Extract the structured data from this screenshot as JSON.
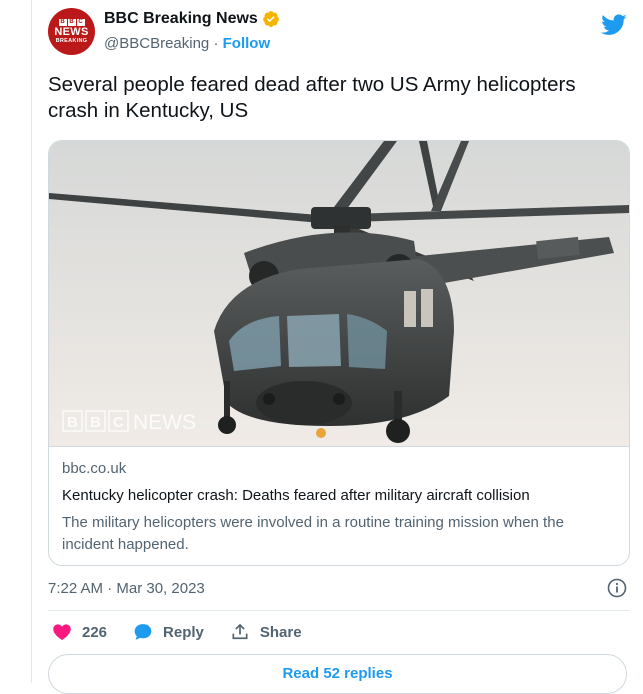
{
  "author": {
    "display_name": "BBC Breaking News",
    "handle": "@BBCBreaking",
    "separator": " · ",
    "follow_label": "Follow",
    "avatar": {
      "blocks": [
        "B",
        "B",
        "C"
      ],
      "line1": "NEWS",
      "line2": "BREAKING"
    }
  },
  "tweet": {
    "text": "Several people feared dead after two US Army helicopters crash in Kentucky, US"
  },
  "card": {
    "image_icon": "helicopter-photo",
    "watermark": "BBC NEWS",
    "domain": "bbc.co.uk",
    "title": "Kentucky helicopter crash: Deaths feared after military aircraft collision",
    "description": "The military helicopters were involved in a routine training mission when the incident happened."
  },
  "meta": {
    "timestamp": "7:22 AM · Mar 30, 2023"
  },
  "actions": {
    "like_count": "226",
    "reply_label": "Reply",
    "share_label": "Share"
  },
  "footer": {
    "read_replies_label": "Read 52 replies"
  },
  "colors": {
    "accent": "#1d9bf0",
    "like": "#f91880",
    "bbc_red": "#bb1919",
    "verified": "#f4b400"
  }
}
